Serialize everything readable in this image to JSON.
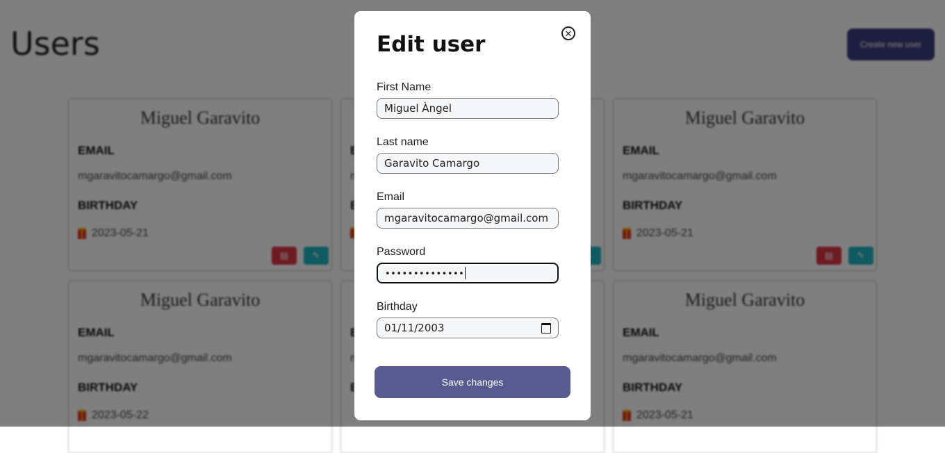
{
  "page": {
    "title": "Users",
    "create_button": "Create new user"
  },
  "cards": [
    {
      "name": "Miguel Garavito",
      "email_label": "EMAIL",
      "email": "mgaravitocamargo@gmail.com",
      "birthday_label": "BIRTHDAY",
      "birthday": "2023-05-21"
    },
    {
      "name": "",
      "email_label": "E",
      "email": "m",
      "birthday_label": "B",
      "birthday": ""
    },
    {
      "name": "Miguel Garavito",
      "email_label": "EMAIL",
      "email": "mgaravitocamargo@gmail.com",
      "birthday_label": "BIRTHDAY",
      "birthday": "2023-05-21"
    },
    {
      "name": "Miguel Garavito",
      "email_label": "EMAIL",
      "email": "mgaravitocamargo@gmail.com",
      "birthday_label": "BIRTHDAY",
      "birthday": "2023-05-22"
    },
    {
      "name": "",
      "email_label": "E",
      "email": "m",
      "birthday_label": "B",
      "birthday": ""
    },
    {
      "name": "Miguel Garavito",
      "email_label": "EMAIL",
      "email": "mgaravitocamargo@gmail.com",
      "birthday_label": "BIRTHDAY",
      "birthday": "2023-05-21"
    }
  ],
  "modal": {
    "title": "Edit user",
    "close_icon": "⊗",
    "fields": {
      "first_name": {
        "label": "First Name",
        "value": "Miguel Àngel"
      },
      "last_name": {
        "label": "Last name",
        "value": "Garavito Camargo"
      },
      "email": {
        "label": "Email",
        "value": "mgaravitocamargo@gmail.com"
      },
      "password": {
        "label": "Password",
        "value": "••••••••••••••"
      },
      "birthday": {
        "label": "Birthday",
        "value": "01/11/2003"
      }
    },
    "save_button": "Save changes"
  },
  "colors": {
    "primary_button": "#3d3f80",
    "delete_button": "#dc3545",
    "edit_button": "#1fb3c0",
    "overlay": "rgba(0,0,0,0.5)"
  },
  "icons": {
    "close": "close-circle-icon",
    "birthday": "gift-icon",
    "delete": "trash-icon",
    "edit": "pencil-icon",
    "calendar": "calendar-icon"
  }
}
